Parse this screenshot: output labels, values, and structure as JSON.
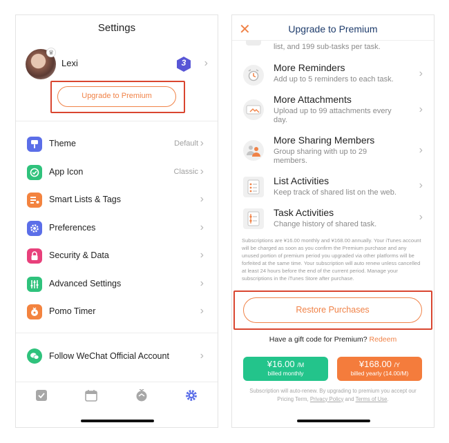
{
  "settings": {
    "title": "Settings",
    "profile": {
      "name": "Lexi",
      "level": "3"
    },
    "upgrade_label": "Upgrade to Premium",
    "menu": [
      {
        "label": "Theme",
        "value": "Default",
        "icon": "theme-icon",
        "color": "#5b6ee8"
      },
      {
        "label": "App Icon",
        "value": "Classic",
        "icon": "app-icon-check",
        "color": "#2fc27c"
      },
      {
        "label": "Smart Lists & Tags",
        "value": "",
        "icon": "smart-lists-icon",
        "color": "#f3833f"
      },
      {
        "label": "Preferences",
        "value": "",
        "icon": "gear-icon",
        "color": "#5b6ee8"
      },
      {
        "label": "Security & Data",
        "value": "",
        "icon": "lock-icon",
        "color": "#e8407b"
      },
      {
        "label": "Advanced Settings",
        "value": "",
        "icon": "sliders-icon",
        "color": "#2fc27c"
      },
      {
        "label": "Pomo Timer",
        "value": "",
        "icon": "pomo-icon",
        "color": "#f3833f"
      }
    ],
    "wechat_label": "Follow WeChat Official Account",
    "tabs": [
      "tasks-tab",
      "calendar-tab",
      "pomo-tab",
      "settings-tab"
    ],
    "active_tab_color": "#5b6ee8"
  },
  "premium": {
    "title": "Upgrade to Premium",
    "cut_text": "list, and 199 sub-tasks per task.",
    "features": [
      {
        "title": "More Reminders",
        "desc": "Add up to 5 reminders to each task.",
        "icon": "alarm-clock-icon"
      },
      {
        "title": "More Attachments",
        "desc": "Upload up to 99 attachments every day.",
        "icon": "attachment-icon"
      },
      {
        "title": "More Sharing Members",
        "desc": "Group sharing with up to 29 members.",
        "icon": "members-icon"
      },
      {
        "title": "List Activities",
        "desc": "Keep track of shared list on the web.",
        "icon": "list-activity-icon"
      },
      {
        "title": "Task Activities",
        "desc": "Change history of shared task.",
        "icon": "task-activity-icon"
      }
    ],
    "fine_print": "Subscriptions are ¥16.00 monthly and ¥168.00 annually. Your iTunes account will be charged as soon as you confirm the Premium purchase and any unused portion of premium period you upgraded via other platforms will be forfeited at the same time. Your subscription will auto renew unless cancelled at least 24 hours before the end of the current period. Manage your subscriptions in the iTunes Store after purchase.",
    "restore_label": "Restore Purchases",
    "gift_text": "Have a gift code for Premium?",
    "redeem_label": "Redeem",
    "monthly": {
      "price": "¥16.00",
      "unit": "/M",
      "billed": "billed monthly",
      "color": "#23c48b"
    },
    "yearly": {
      "price": "¥168.00",
      "unit": "/Y",
      "billed": "billed yearly (14.00/M)",
      "color": "#f47c3c"
    },
    "renew_note_pre": "Subscription will auto-renew. By upgrading to premium you accept our Pricing Term,",
    "privacy_label": "Privacy Policy",
    "and_text": "and",
    "terms_label": "Terms of Use",
    "accent": "#f08247"
  }
}
